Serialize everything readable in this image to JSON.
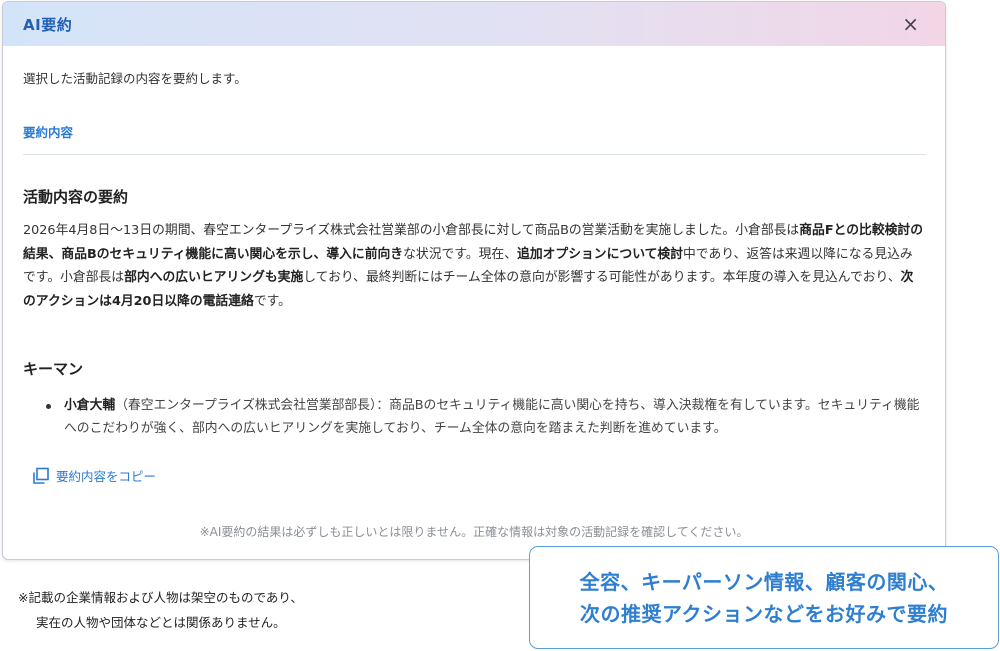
{
  "dialog": {
    "title": "AI要約",
    "close_icon": "×",
    "intro": "選択した活動記録の内容を要約します。",
    "section_tab": "要約内容",
    "summary": {
      "heading": "活動内容の要約",
      "p1": "2026年4月8日～13日の期間、春空エンタープライズ株式会社営業部の小倉部長に対して商品Bの営業活動を実施しました。小倉部長は",
      "b1": "商品Fとの比較検討の結果、商品Bのセキュリティ機能に高い関心を示し、導入に前向き",
      "p2": "な状況です。現在、",
      "b2": "追加オプションについて検討",
      "p3": "中であり、返答は来週以降になる見込みです。小倉部長は",
      "b3": "部内への広いヒアリングも実施",
      "p4": "しており、最終判断にはチーム全体の意向が影響する可能性があります。本年度の導入を見込んでおり、",
      "b4": "次のアクションは4月20日以降の電話連絡",
      "p5": "です。"
    },
    "keyman": {
      "heading": "キーマン",
      "name": "小倉大輔",
      "text": "（春空エンタープライズ株式会社営業部部長）：商品Bのセキュリティ機能に高い関心を持ち、導入決裁権を有しています。セキュリティ機能へのこだわりが強く、部内への広いヒアリングを実施しており、チーム全体の意向を踏まえた判断を進めています。"
    },
    "copy_label": "要約内容をコピー",
    "disclaimer": "※AI要約の結果は必ずしも正しいとは限りません。正確な情報は対象の活動記録を確認してください。"
  },
  "footnote": {
    "line1": "※記載の企業情報および人物は架空のものであり、",
    "line2": "実在の人物や団体などとは関係ありません。"
  },
  "callout": {
    "line1": "全容、キーパーソン情報、顧客の関心、",
    "line2": "次の推奨アクションなどをお好みで要約"
  },
  "colors": {
    "accent": "#2a7bd4",
    "title": "#1f5fb8",
    "header_gradient_start": "#d4e4f8",
    "header_gradient_end": "#f2d6e6"
  },
  "icons": {
    "close": "close-icon",
    "copy": "copy-icon"
  }
}
